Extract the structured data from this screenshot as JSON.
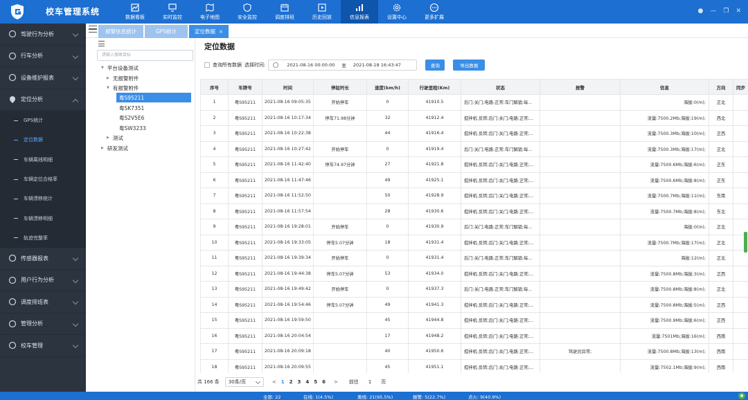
{
  "app": {
    "title": "校车管理系统"
  },
  "nav": [
    {
      "label": "数据看板",
      "icon": "dashboard-icon"
    },
    {
      "label": "实时监控",
      "icon": "monitor-icon"
    },
    {
      "label": "电子地图",
      "icon": "map-icon"
    },
    {
      "label": "安全监控",
      "icon": "shield-icon"
    },
    {
      "label": "调度排班",
      "icon": "schedule-icon"
    },
    {
      "label": "历史回放",
      "icon": "history-icon"
    },
    {
      "label": "信息报表",
      "icon": "report-icon"
    },
    {
      "label": "设置中心",
      "icon": "gear-icon"
    },
    {
      "label": "更多扩展",
      "icon": "more-icon"
    }
  ],
  "nav_active": 6,
  "sidebar": {
    "items": [
      {
        "label": "驾驶行为分析"
      },
      {
        "label": "行车分析"
      },
      {
        "label": "设备维护报表"
      },
      {
        "label": "定位分析"
      },
      {
        "label": "传感器报表"
      },
      {
        "label": "用户行为分析"
      },
      {
        "label": "调度排班表"
      },
      {
        "label": "管理分析"
      },
      {
        "label": "校车管理"
      }
    ],
    "subitems": [
      {
        "label": "GPS统计"
      },
      {
        "label": "定位数据"
      },
      {
        "label": "车辆离线明细"
      },
      {
        "label": "车辆定位合格率"
      },
      {
        "label": "车辆漂移统计"
      },
      {
        "label": "车辆漂移明细"
      },
      {
        "label": "轨迹完整率"
      }
    ]
  },
  "tabs": [
    {
      "label": "报警信息统计"
    },
    {
      "label": "GPS统计"
    },
    {
      "label": "定位数据",
      "close": "×"
    }
  ],
  "tree": {
    "search_placeholder": "请输入搜索目标",
    "nodes": [
      {
        "label": "平台设备测试",
        "tri": "▼"
      },
      {
        "label": "无报警附件",
        "tri": "▶"
      },
      {
        "label": "有报警附件",
        "tri": "▼"
      },
      {
        "label": "粤S95211",
        "tri": ""
      },
      {
        "label": "粤SK7351",
        "tri": ""
      },
      {
        "label": "粤S2V5E6",
        "tri": ""
      },
      {
        "label": "粤SW3233",
        "tri": ""
      },
      {
        "label": "测试",
        "tri": "▶"
      },
      {
        "label": "研发测试",
        "tri": "▶"
      }
    ]
  },
  "main": {
    "title": "定位数据",
    "query_all_label": "查询所有数据",
    "time_label": "选择时间:",
    "start_time": "2021-08-16 00:00:00",
    "to_label": "至",
    "end_time": "2021-08-18 16:43:47",
    "query_button": "查询",
    "export_button": "导出数据"
  },
  "table": {
    "columns": [
      "序号",
      "车牌号",
      "时间",
      "停驻时长",
      "速度(km/h)",
      "行驶里程(Km)",
      "状态",
      "报警",
      "信息",
      "方向",
      "同步"
    ],
    "rows": [
      [
        "1",
        "粤S95211",
        "2021-08-16 09:05:35",
        "开始停车",
        "0",
        "41910.5",
        "后门:关门;电路:正常;车门解锁;每...",
        "",
        "海拔:0(m);",
        "正北",
        ""
      ],
      [
        "2",
        "粤S95211",
        "2021-08-16 10:17:34",
        "停车71.98分钟",
        "32",
        "41912.4",
        "搅拌机:反转;后门:关门;电路:正常;...",
        "",
        "流量:7500.2Mb;海拔:19(m);",
        "西北",
        ""
      ],
      [
        "3",
        "粤S95211",
        "2021-08-16 10:22:38",
        "",
        "44",
        "41916.4",
        "搅拌机:反转;后门:关门;电路:正常;...",
        "",
        "流量:7500.3Mb;海拔:10(m);",
        "正西",
        ""
      ],
      [
        "4",
        "粤S95211",
        "2021-08-16 10:27:42",
        "开始停车",
        "0",
        "41919.4",
        "后门:关门;电路:正常;车门解锁;每...",
        "",
        "流量:7500.3Mb;海拔:17(m);",
        "正北",
        ""
      ],
      [
        "5",
        "粤S95211",
        "2021-08-16 11:42:40",
        "停车74.97分钟",
        "27",
        "41921.8",
        "搅拌机:反转;后门:关门;电路:正常;...",
        "",
        "流量:7500.6Mb;海拔:6(m);",
        "正东",
        ""
      ],
      [
        "6",
        "粤S95211",
        "2021-08-16 11:47:46",
        "",
        "49",
        "41925.1",
        "搅拌机:反转;后门:关门;电路:正常;...",
        "",
        "流量:7500.6Mb;海拔:8(m);",
        "正东",
        ""
      ],
      [
        "7",
        "粤S95211",
        "2021-08-16 11:52:50",
        "",
        "50",
        "41928.9",
        "搅拌机:反转;后门:关门;电路:正常;...",
        "",
        "流量:7500.7Mb;海拔:11(m);",
        "东南",
        ""
      ],
      [
        "8",
        "粤S95211",
        "2021-08-16 11:57:54",
        "",
        "28",
        "41930.6",
        "搅拌机:反转;后门:关门;电路:正常;...",
        "",
        "流量:7500.7Mb;海拔:8(m);",
        "东北",
        ""
      ],
      [
        "9",
        "粤S95211",
        "2021-08-16 19:28:01",
        "开始停车",
        "0",
        "41930.9",
        "后门:关门;电路:正常;车门解锁;每...",
        "",
        "海拔:0(m);",
        "正北",
        ""
      ],
      [
        "10",
        "粤S95211",
        "2021-08-16 19:33:05",
        "停车5.07分钟",
        "18",
        "41931.4",
        "搅拌机:反转;后门:关门;电路:正常;...",
        "",
        "流量:7500.7Mb;海拔:17(m);",
        "正北",
        ""
      ],
      [
        "11",
        "粤S95211",
        "2021-08-16 19:39:34",
        "开始停车",
        "0",
        "41931.4",
        "后门:关门;电路:正常;车门解锁;每...",
        "",
        "海拔:12(m);",
        "正北",
        ""
      ],
      [
        "12",
        "粤S95211",
        "2021-08-16 19:44:38",
        "停车5.07分钟",
        "53",
        "41934.0",
        "搅拌机:反转;后门:关门;电路:正常;...",
        "",
        "流量:7500.8Mb;海拔:3(m);",
        "正西",
        ""
      ],
      [
        "13",
        "粤S95211",
        "2021-08-16 19:49:42",
        "开始停车",
        "0",
        "41937.3",
        "后门:关门;电路:正常;车门解锁;每...",
        "",
        "流量:7500.8Mb;海拔:8(m);",
        "正北",
        ""
      ],
      [
        "14",
        "粤S95211",
        "2021-08-16 19:54:46",
        "停车5.07分钟",
        "49",
        "41941.3",
        "搅拌机:反转;后门:关门;电路:正常;...",
        "",
        "流量:7500.8Mb;海拔:5(m);",
        "正西",
        ""
      ],
      [
        "15",
        "粤S95211",
        "2021-08-16 19:59:50",
        "",
        "45",
        "41944.8",
        "搅拌机:反转;后门:关门;电路:正常;...",
        "",
        "流量:7500.9Mb;海拔:6(m);",
        "正西",
        ""
      ],
      [
        "16",
        "粤S95211",
        "2021-08-16 20:04:54",
        "",
        "17",
        "41948.2",
        "搅拌机:反转;后门:关门;电路:正常;...",
        "",
        "流量:7501Mb;海拔:16(m);",
        "西南",
        ""
      ],
      [
        "17",
        "粤S95211",
        "2021-08-16 20:09:18",
        "",
        "40",
        "41950.6",
        "搅拌机:反转;后门:关门;电路:正常;...",
        "驾驶员异常;",
        "流量:7500.8Mb;海拔:13(m);",
        "西南",
        ""
      ],
      [
        "18",
        "粤S95211",
        "2021-08-16 20:09:55",
        "",
        "45",
        "41951.1",
        "搅拌机:反转;后门:关门;电路:正常;...",
        "",
        "流量:7502.1Mb;海拔:9(m);",
        "西南",
        ""
      ]
    ]
  },
  "pager": {
    "total": "共 166 条",
    "page_size": "30条/页",
    "prev": "<",
    "next": ">",
    "pages": [
      "1",
      "2",
      "3",
      "4",
      "5",
      "6"
    ],
    "current": "1",
    "goto_label": "前往",
    "goto_value": "1",
    "page_unit": "页"
  },
  "status": {
    "total": "全部: 22",
    "online": "在线: 1(4.5%)",
    "offline": "离线: 21(95.5%)",
    "alarm": "报警: 5(22.7%)",
    "ignition": "点火: 9(40.9%)"
  },
  "colors": {
    "primary": "#1d6fd1",
    "active_nav": "#0d55ad",
    "sidebar": "#2c3440",
    "accent": "#3b8ee6",
    "online": "#4caf50"
  }
}
